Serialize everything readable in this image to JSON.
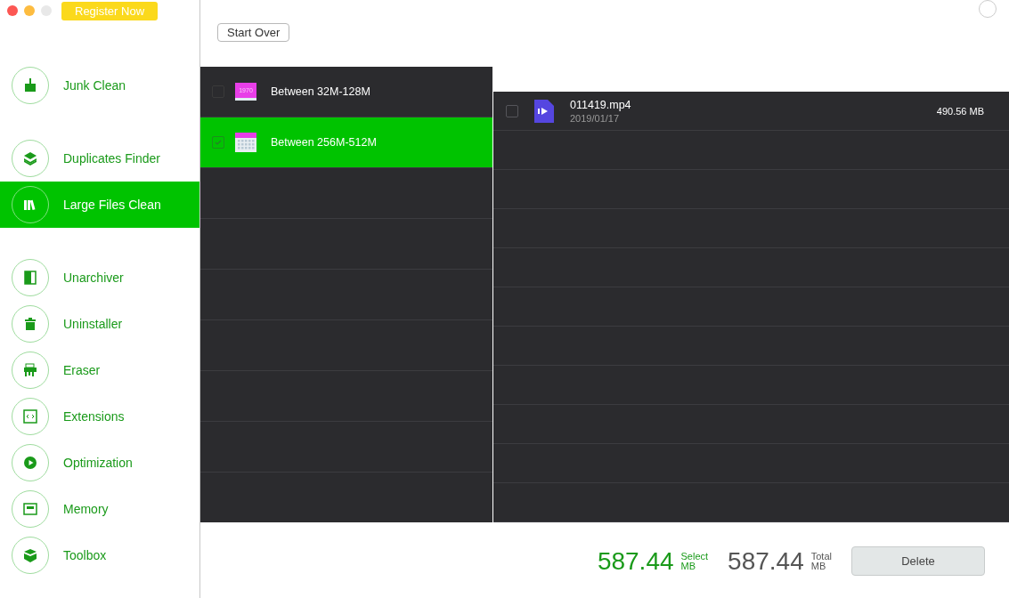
{
  "register_button": "Register Now",
  "sidebar": {
    "groups": [
      {
        "items": [
          {
            "label": "Junk Clean",
            "kind": "broom",
            "selected": false
          }
        ]
      },
      {
        "items": [
          {
            "label": "Duplicates Finder",
            "kind": "layers",
            "selected": false
          },
          {
            "label": "Large Files Clean",
            "kind": "books",
            "selected": true
          }
        ]
      },
      {
        "items": [
          {
            "label": "Unarchiver",
            "kind": "door",
            "selected": false
          },
          {
            "label": "Uninstaller",
            "kind": "trash",
            "selected": false
          },
          {
            "label": "Eraser",
            "kind": "shredder",
            "selected": false
          },
          {
            "label": "Extensions",
            "kind": "code",
            "selected": false
          },
          {
            "label": "Optimization",
            "kind": "play",
            "selected": false
          },
          {
            "label": "Memory",
            "kind": "chip",
            "selected": false
          },
          {
            "label": "Toolbox",
            "kind": "box",
            "selected": false
          }
        ]
      }
    ]
  },
  "start_over_button": "Start Over",
  "categories": [
    {
      "label": "Between 32M-128M",
      "kind": "year",
      "icon_text": "1970",
      "checked": false,
      "selected": false
    },
    {
      "label": "Between 256M-512M",
      "kind": "calendar",
      "checked": true,
      "selected": true
    }
  ],
  "files": [
    {
      "name": "011419.mp4",
      "date": "2019/01/17",
      "size": "490.56 MB",
      "checked": false
    }
  ],
  "footer": {
    "selected_value": "587.44",
    "selected_label": "Select",
    "selected_unit": "MB",
    "total_value": "587.44",
    "total_label": "Total",
    "total_unit": "MB",
    "delete_button": "Delete"
  }
}
